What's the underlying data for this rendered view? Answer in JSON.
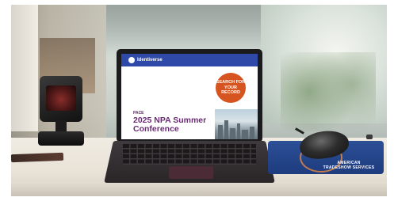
{
  "laptop_screen": {
    "brand": "Identiverse",
    "search_badge": "SEARCH FOR YOUR RECORD",
    "logo": "PACE",
    "title_line1": "2025 NPA Summer",
    "title_line2": "Conference"
  },
  "mousepad": {
    "brand_line1": "AMERICAN",
    "brand_line2": "TRADESHOW SERVICES"
  },
  "colors": {
    "screen_header": "#2e49a8",
    "search_badge": "#d6541f",
    "title": "#6b2b75",
    "mousepad": "#2c4f96"
  }
}
